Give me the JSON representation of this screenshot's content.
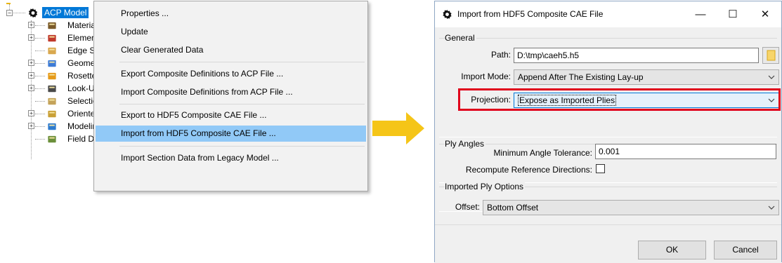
{
  "tree": {
    "root_label": "ACP Model",
    "items": [
      {
        "label": "Materials",
        "icon": "materials-icon"
      },
      {
        "label": "Element Sets",
        "icon": "element-sets-icon"
      },
      {
        "label": "Edge Sets",
        "icon": "edge-sets-icon"
      },
      {
        "label": "Geometry",
        "icon": "geometry-icon"
      },
      {
        "label": "Rosettes",
        "icon": "rosettes-icon"
      },
      {
        "label": "Look-Up Tables",
        "icon": "lookup-tables-icon"
      },
      {
        "label": "Selection Rules",
        "icon": "selection-rules-icon"
      },
      {
        "label": "Oriented Selection Sets",
        "icon": "oriented-selection-sets-icon"
      },
      {
        "label": "Modeling Groups",
        "icon": "modeling-groups-icon"
      },
      {
        "label": "Field Definitions",
        "icon": "field-definitions-icon"
      }
    ]
  },
  "context_menu": {
    "items": [
      "Properties ...",
      "Update",
      "Clear Generated Data",
      "Export Composite Definitions to ACP File ...",
      "Import Composite Definitions from ACP File ...",
      "Export to HDF5 Composite CAE File ...",
      "Import from HDF5 Composite CAE File ...",
      "Import Section Data from Legacy Model ..."
    ],
    "highlighted_index": 6
  },
  "dialog": {
    "title": "Import from HDF5 Composite CAE File",
    "titlebar_buttons": {
      "minimize": "—",
      "maximize": "☐",
      "close": "✕"
    },
    "general": {
      "title": "General",
      "path_label": "Path:",
      "path_value": "D:\\tmp\\caeh5.h5",
      "import_mode_label": "Import Mode:",
      "import_mode_value": "Append After The Existing Lay-up",
      "projection_label": "Projection:",
      "projection_value": "Expose as Imported Plies"
    },
    "ply_angles": {
      "title": "Ply Angles",
      "tolerance_label": "Minimum Angle Tolerance:",
      "tolerance_value": "0.001",
      "recompute_label": "Recompute Reference Directions:",
      "recompute_checked": false
    },
    "imported_ply_options": {
      "title": "Imported Ply Options",
      "offset_label": "Offset:",
      "offset_value": "Bottom Offset"
    },
    "buttons": {
      "ok": "OK",
      "cancel": "Cancel"
    }
  },
  "colors": {
    "selection": "#0078d7",
    "menu_highlight": "#91c9f7",
    "callout_arrow": "#f5c518",
    "highlight_box": "#e0001b"
  }
}
